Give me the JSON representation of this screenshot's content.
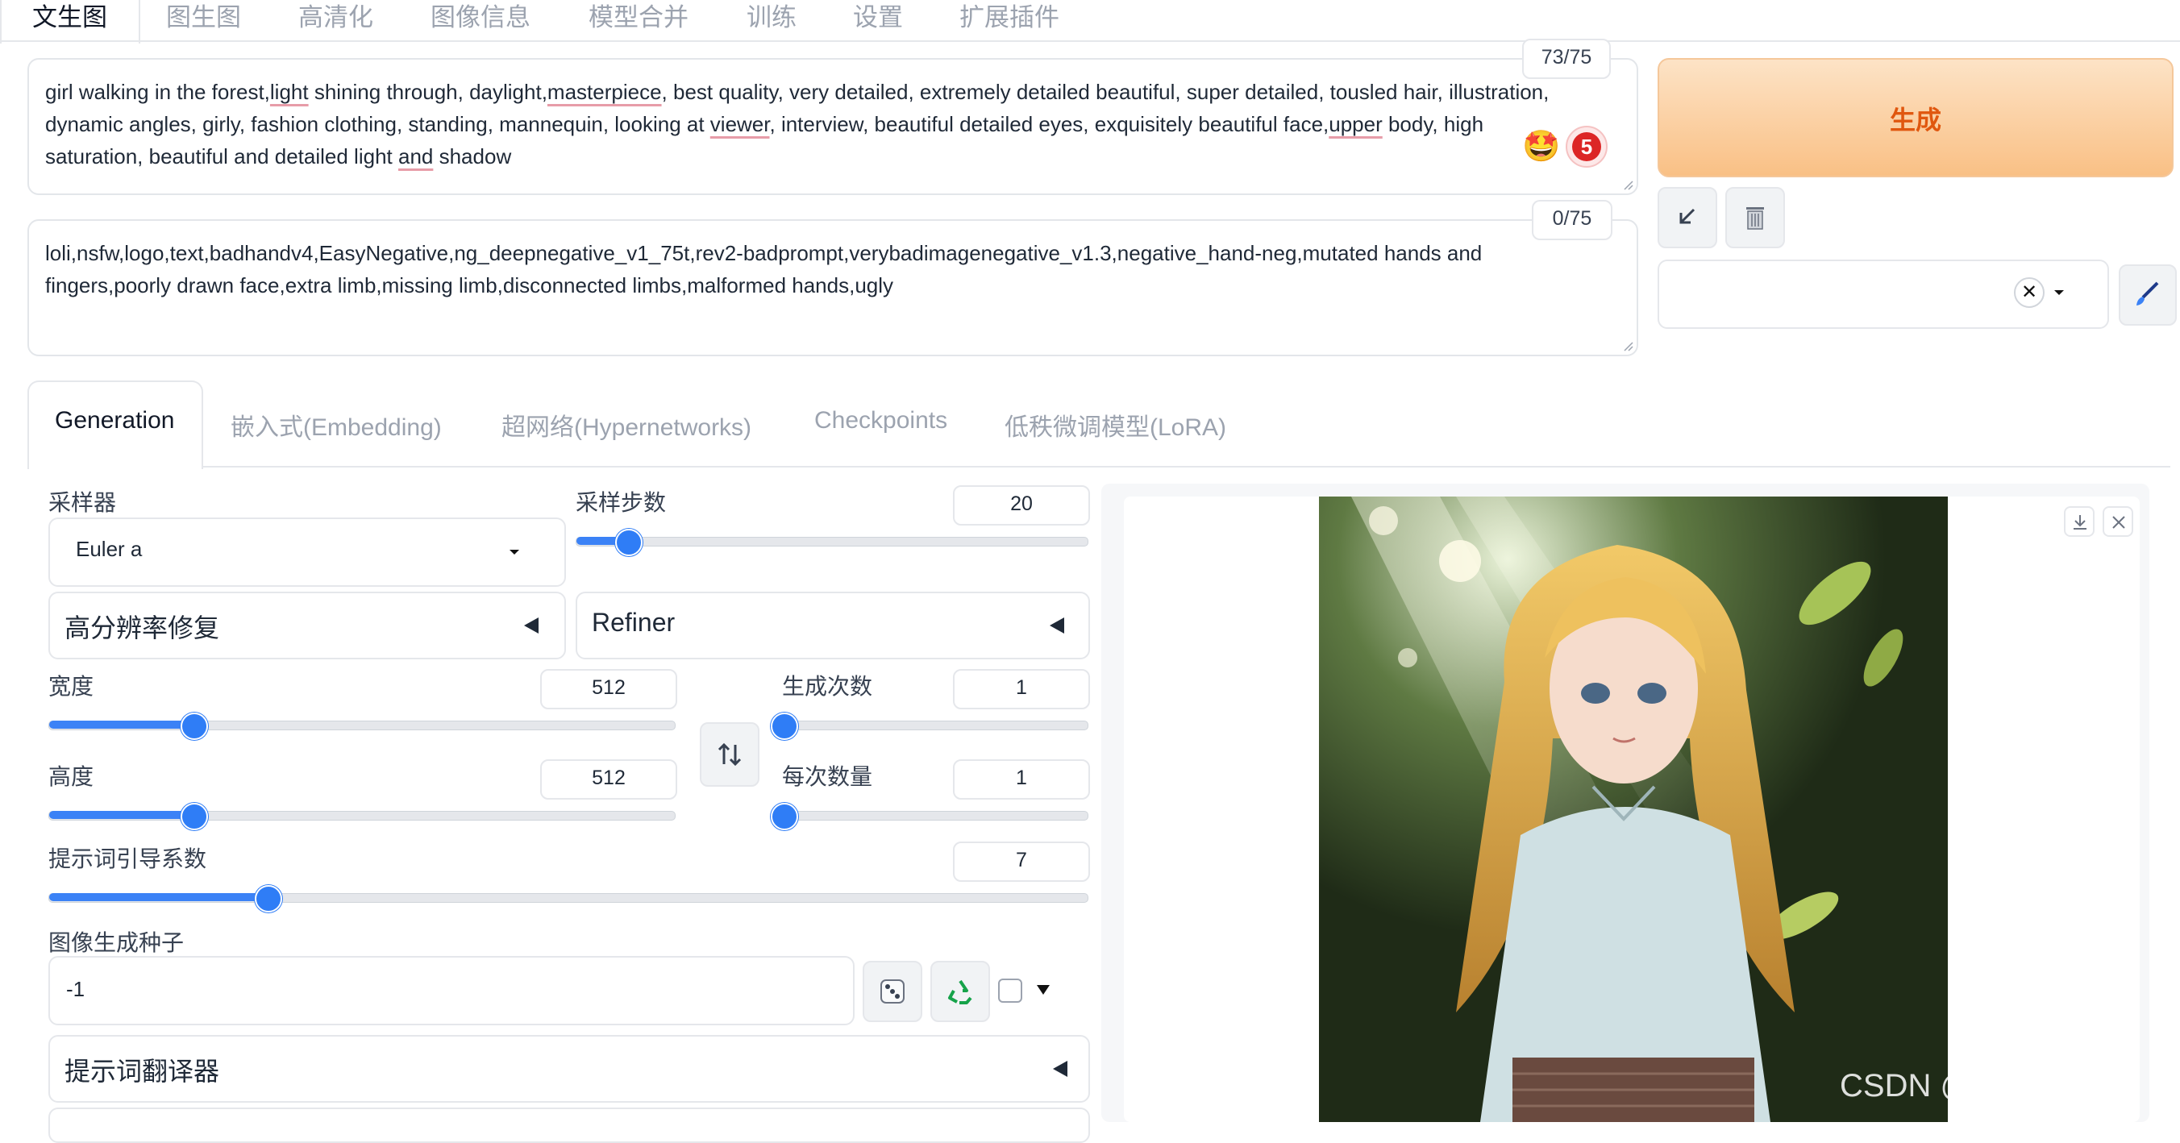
{
  "top_tabs": [
    "文生图",
    "图生图",
    "高清化",
    "图像信息",
    "模型合并",
    "训练",
    "设置",
    "扩展插件"
  ],
  "prompt": {
    "counter": "73/75",
    "line1": [
      "girl walking in the forest,",
      "light",
      " shining through, daylight,",
      "masterpiece",
      ", best quality, very detailed, extremely detailed beautiful, super detailed, tousled hair, illustration,"
    ],
    "line2": [
      "dynamic angles, girly, fashion clothing, standing, mannequin, looking at ",
      "viewer",
      ", interview, beautiful detailed eyes, exquisitely beautiful face,",
      "upper",
      " body, high"
    ],
    "line3": [
      "saturation, beautiful and detailed light ",
      "and",
      " shadow"
    ],
    "emoji": "🤩",
    "badge": "5"
  },
  "negative": {
    "counter": "0/75",
    "line1": "loli,nsfw,logo,text,badhandv4,EasyNegative,ng_deepnegative_v1_75t,rev2-badprompt,verybadimagenegative_v1.3,negative_hand-neg,mutated hands and",
    "line2": "fingers,poorly drawn face,extra limb,missing limb,disconnected limbs,malformed hands,ugly"
  },
  "generate": {
    "label": "生成"
  },
  "sub_tabs": [
    "Generation",
    "嵌入式(Embedding)",
    "超网络(Hypernetworks)",
    "Checkpoints",
    "低秩微调模型(LoRA)"
  ],
  "params": {
    "sampler_label": "采样器",
    "sampler_value": "Euler a",
    "steps_label": "采样步数",
    "steps_value": "20",
    "hires_label": "高分辨率修复",
    "refiner_label": "Refiner",
    "width_label": "宽度",
    "width_value": "512",
    "height_label": "高度",
    "height_value": "512",
    "batch_count_label": "生成次数",
    "batch_count_value": "1",
    "batch_size_label": "每次数量",
    "batch_size_value": "1",
    "cfg_label": "提示词引导系数",
    "cfg_value": "7",
    "seed_label": "图像生成种子",
    "seed_value": "-1",
    "translator_label": "提示词翻译器"
  },
  "sliders": {
    "steps": 0.1,
    "width": 0.23,
    "height": 0.23,
    "batch_count": 0.0,
    "batch_size": 0.0,
    "cfg": 0.21
  },
  "watermark": "CSDN @AIGC绘画",
  "colors": {
    "accent": "#2f7df6",
    "generate_text": "#e0570f",
    "generate_bg": "#f9c085"
  },
  "icons": [
    "paste-icon",
    "trash-icon",
    "clear-icon",
    "dropdown-icon",
    "brush-icon",
    "swap-icon",
    "dice-icon",
    "recycle-icon",
    "download-icon",
    "close-icon"
  ]
}
